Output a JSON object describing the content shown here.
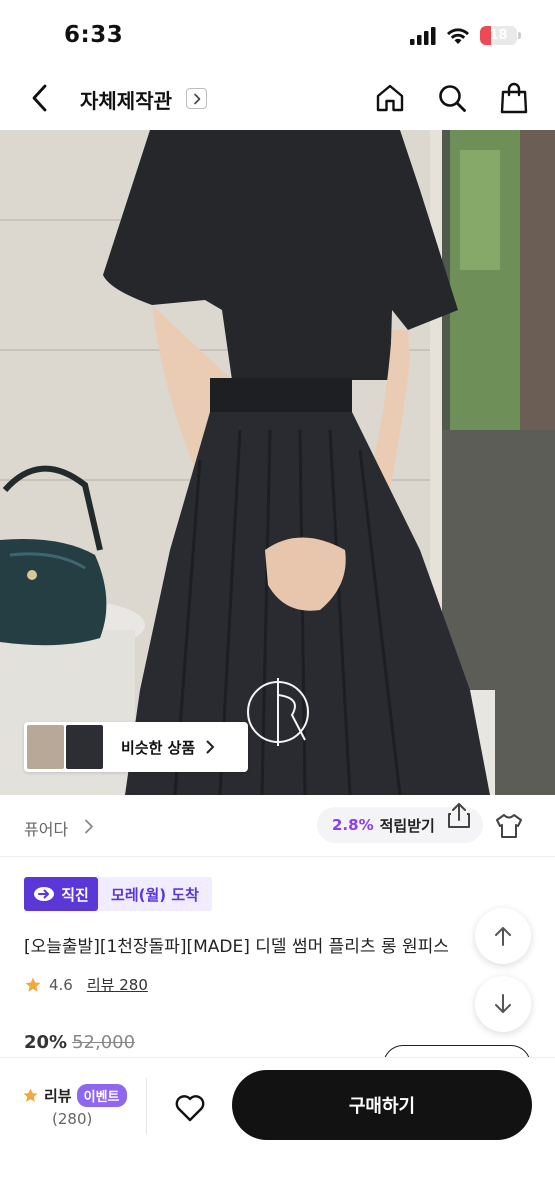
{
  "status_bar": {
    "time": "6:33",
    "battery_level": "18",
    "battery_color": "#ec4a55"
  },
  "header": {
    "title": "자체제작관",
    "icons": [
      "back-icon",
      "title-arrow-icon",
      "home-icon",
      "search-icon",
      "shopping-bag-icon"
    ]
  },
  "hero": {
    "similar_products_label": "비슷한 상품"
  },
  "brand": {
    "name": "퓨어다",
    "points_rate": "2.8%",
    "points_label": "적립받기"
  },
  "tags": {
    "direct": "직진",
    "arrival": "모레(월) 도착",
    "direct_color": "#5a37d6"
  },
  "product": {
    "title": "[오늘출발][1천장돌파][MADE] 디델 썸머 플리츠 롱 원피스",
    "rating": "4.6",
    "review_link": "리뷰 280",
    "discount": "20%",
    "original_price": "52,000"
  },
  "bottom_bar": {
    "review_label": "리뷰",
    "event_badge": "이벤트",
    "review_count": "(280)",
    "buy_label": "구매하기"
  }
}
